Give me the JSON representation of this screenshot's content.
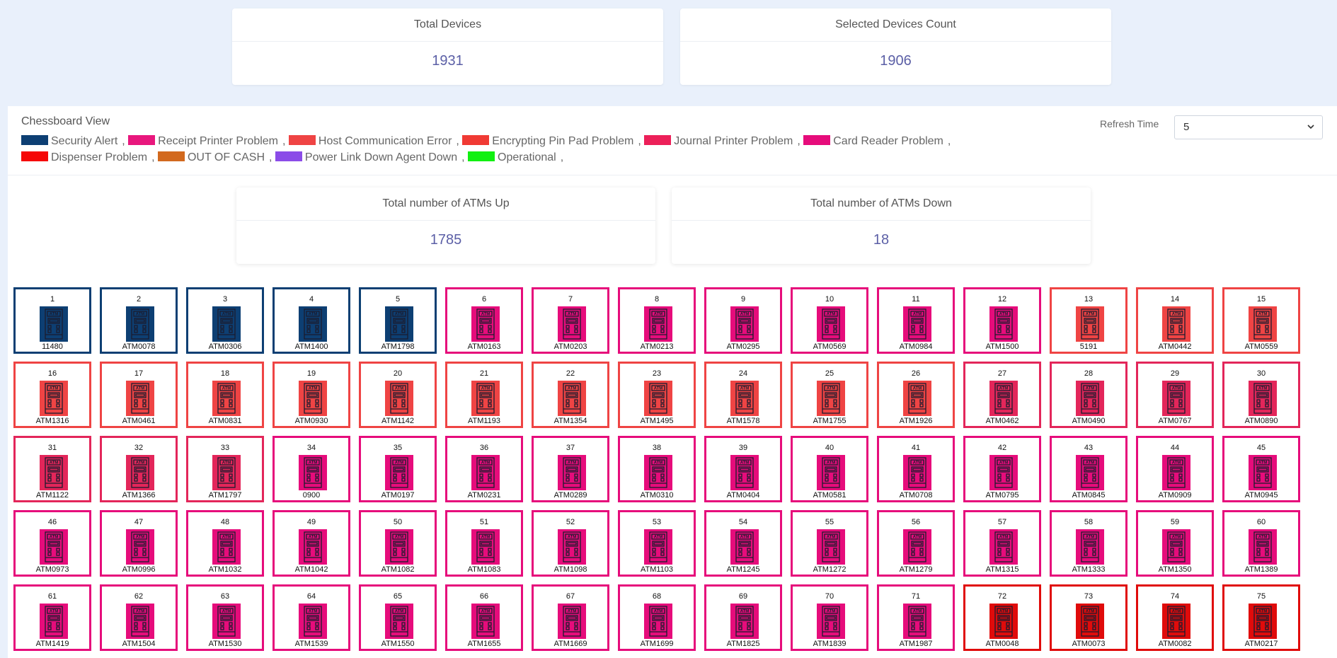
{
  "stats": {
    "total_devices": {
      "label": "Total Devices",
      "value": "1931"
    },
    "selected_devices": {
      "label": "Selected Devices Count",
      "value": "1906"
    }
  },
  "panel": {
    "title": "Chessboard View",
    "refresh_label": "Refresh Time",
    "refresh_value": "5",
    "legend": [
      {
        "label": "Security Alert",
        "color": "#0d3f73"
      },
      {
        "label": "Receipt Printer Problem",
        "color": "#e8177d"
      },
      {
        "label": "Host Communication Error",
        "color": "#ef4444"
      },
      {
        "label": "Encrypting Pin Pad Problem",
        "color": "#f03a34"
      },
      {
        "label": "Journal Printer Problem",
        "color": "#ec2059"
      },
      {
        "label": "Card Reader Problem",
        "color": "#e60c7b"
      },
      {
        "label": "Dispenser Problem",
        "color": "#f50707"
      },
      {
        "label": "OUT OF CASH",
        "color": "#d2691e"
      },
      {
        "label": "Power Link Down Agent Down",
        "color": "#8b4ce8"
      },
      {
        "label": "Operational",
        "color": "#11f011"
      }
    ],
    "atms_up": {
      "label": "Total number of ATMs Up",
      "value": "1785"
    },
    "atms_down": {
      "label": "Total number of ATMs Down",
      "value": "18"
    }
  },
  "status_colors": {
    "security": "#0d3f73",
    "receipt": "#e60c7b",
    "host": "#ef4444",
    "journal": "#e3265a",
    "dispenser": "#e00b0b"
  },
  "tiles": [
    {
      "num": "1",
      "id": "11480",
      "status": "security"
    },
    {
      "num": "2",
      "id": "ATM0078",
      "status": "security"
    },
    {
      "num": "3",
      "id": "ATM0306",
      "status": "security"
    },
    {
      "num": "4",
      "id": "ATM1400",
      "status": "security"
    },
    {
      "num": "5",
      "id": "ATM1798",
      "status": "security"
    },
    {
      "num": "6",
      "id": "ATM0163",
      "status": "receipt"
    },
    {
      "num": "7",
      "id": "ATM0203",
      "status": "receipt"
    },
    {
      "num": "8",
      "id": "ATM0213",
      "status": "receipt"
    },
    {
      "num": "9",
      "id": "ATM0295",
      "status": "receipt"
    },
    {
      "num": "10",
      "id": "ATM0569",
      "status": "receipt"
    },
    {
      "num": "11",
      "id": "ATM0984",
      "status": "receipt"
    },
    {
      "num": "12",
      "id": "ATM1500",
      "status": "receipt"
    },
    {
      "num": "13",
      "id": "5191",
      "status": "host"
    },
    {
      "num": "14",
      "id": "ATM0442",
      "status": "host"
    },
    {
      "num": "15",
      "id": "ATM0559",
      "status": "host"
    },
    {
      "num": "16",
      "id": "ATM1316",
      "status": "host"
    },
    {
      "num": "17",
      "id": "ATM0461",
      "status": "host"
    },
    {
      "num": "18",
      "id": "ATM0831",
      "status": "host"
    },
    {
      "num": "19",
      "id": "ATM0930",
      "status": "host"
    },
    {
      "num": "20",
      "id": "ATM1142",
      "status": "host"
    },
    {
      "num": "21",
      "id": "ATM1193",
      "status": "host"
    },
    {
      "num": "22",
      "id": "ATM1354",
      "status": "host"
    },
    {
      "num": "23",
      "id": "ATM1495",
      "status": "host"
    },
    {
      "num": "24",
      "id": "ATM1578",
      "status": "host"
    },
    {
      "num": "25",
      "id": "ATM1755",
      "status": "host"
    },
    {
      "num": "26",
      "id": "ATM1926",
      "status": "host"
    },
    {
      "num": "27",
      "id": "ATM0462",
      "status": "journal"
    },
    {
      "num": "28",
      "id": "ATM0490",
      "status": "journal"
    },
    {
      "num": "29",
      "id": "ATM0767",
      "status": "journal"
    },
    {
      "num": "30",
      "id": "ATM0890",
      "status": "journal"
    },
    {
      "num": "31",
      "id": "ATM1122",
      "status": "journal"
    },
    {
      "num": "32",
      "id": "ATM1366",
      "status": "journal"
    },
    {
      "num": "33",
      "id": "ATM1797",
      "status": "journal"
    },
    {
      "num": "34",
      "id": "0900",
      "status": "receipt"
    },
    {
      "num": "35",
      "id": "ATM0197",
      "status": "receipt"
    },
    {
      "num": "36",
      "id": "ATM0231",
      "status": "receipt"
    },
    {
      "num": "37",
      "id": "ATM0289",
      "status": "receipt"
    },
    {
      "num": "38",
      "id": "ATM0310",
      "status": "receipt"
    },
    {
      "num": "39",
      "id": "ATM0404",
      "status": "receipt"
    },
    {
      "num": "40",
      "id": "ATM0581",
      "status": "receipt"
    },
    {
      "num": "41",
      "id": "ATM0708",
      "status": "receipt"
    },
    {
      "num": "42",
      "id": "ATM0795",
      "status": "receipt"
    },
    {
      "num": "43",
      "id": "ATM0845",
      "status": "receipt"
    },
    {
      "num": "44",
      "id": "ATM0909",
      "status": "receipt"
    },
    {
      "num": "45",
      "id": "ATM0945",
      "status": "receipt"
    },
    {
      "num": "46",
      "id": "ATM0973",
      "status": "receipt"
    },
    {
      "num": "47",
      "id": "ATM0996",
      "status": "receipt"
    },
    {
      "num": "48",
      "id": "ATM1032",
      "status": "receipt"
    },
    {
      "num": "49",
      "id": "ATM1042",
      "status": "receipt"
    },
    {
      "num": "50",
      "id": "ATM1082",
      "status": "receipt"
    },
    {
      "num": "51",
      "id": "ATM1083",
      "status": "receipt"
    },
    {
      "num": "52",
      "id": "ATM1098",
      "status": "receipt"
    },
    {
      "num": "53",
      "id": "ATM1103",
      "status": "receipt"
    },
    {
      "num": "54",
      "id": "ATM1245",
      "status": "receipt"
    },
    {
      "num": "55",
      "id": "ATM1272",
      "status": "receipt"
    },
    {
      "num": "56",
      "id": "ATM1279",
      "status": "receipt"
    },
    {
      "num": "57",
      "id": "ATM1315",
      "status": "receipt"
    },
    {
      "num": "58",
      "id": "ATM1333",
      "status": "receipt"
    },
    {
      "num": "59",
      "id": "ATM1350",
      "status": "receipt"
    },
    {
      "num": "60",
      "id": "ATM1389",
      "status": "receipt"
    },
    {
      "num": "61",
      "id": "ATM1419",
      "status": "receipt"
    },
    {
      "num": "62",
      "id": "ATM1504",
      "status": "receipt"
    },
    {
      "num": "63",
      "id": "ATM1530",
      "status": "receipt"
    },
    {
      "num": "64",
      "id": "ATM1539",
      "status": "receipt"
    },
    {
      "num": "65",
      "id": "ATM1550",
      "status": "receipt"
    },
    {
      "num": "66",
      "id": "ATM1655",
      "status": "receipt"
    },
    {
      "num": "67",
      "id": "ATM1669",
      "status": "receipt"
    },
    {
      "num": "68",
      "id": "ATM1699",
      "status": "receipt"
    },
    {
      "num": "69",
      "id": "ATM1825",
      "status": "receipt"
    },
    {
      "num": "70",
      "id": "ATM1839",
      "status": "receipt"
    },
    {
      "num": "71",
      "id": "ATM1987",
      "status": "receipt"
    },
    {
      "num": "72",
      "id": "ATM0048",
      "status": "dispenser"
    },
    {
      "num": "73",
      "id": "ATM0073",
      "status": "dispenser"
    },
    {
      "num": "74",
      "id": "ATM0082",
      "status": "dispenser"
    },
    {
      "num": "75",
      "id": "ATM0217",
      "status": "dispenser"
    }
  ],
  "icon_text": "ATM"
}
